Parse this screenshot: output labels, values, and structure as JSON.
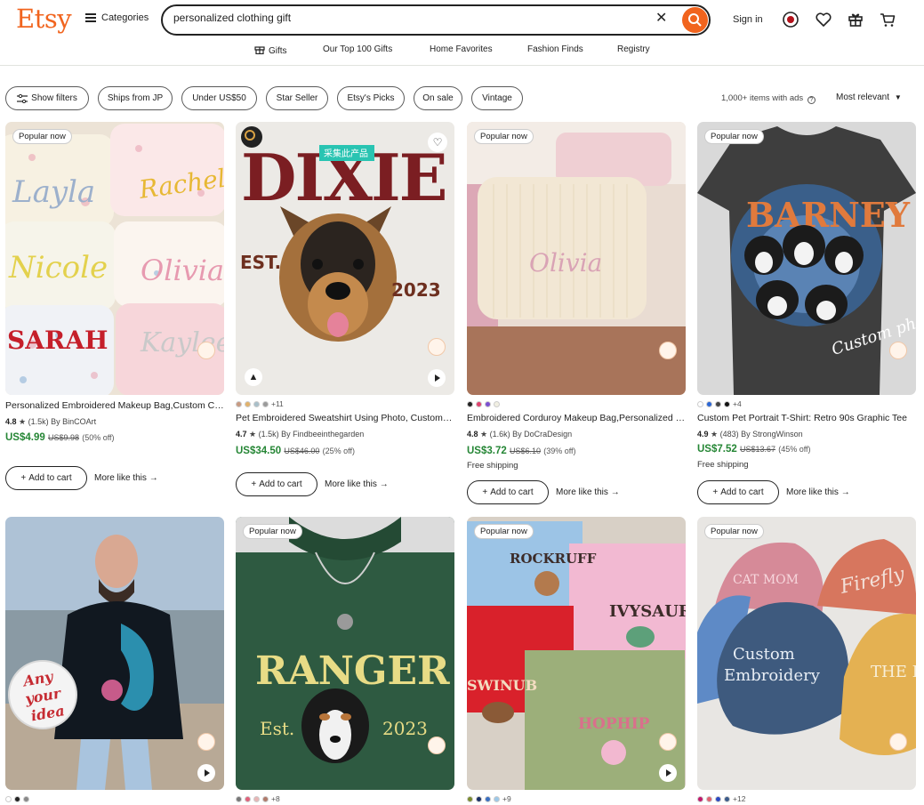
{
  "header": {
    "logo": "Etsy",
    "categories": "Categories",
    "search_value": "personalized clothing gift",
    "signin": "Sign in"
  },
  "nav": [
    "Gifts",
    "Our Top 100 Gifts",
    "Home Favorites",
    "Fashion Finds",
    "Registry"
  ],
  "filters": [
    "Show filters",
    "Ships from JP",
    "Under US$50",
    "Star Seller",
    "Etsy's Picks",
    "On sale",
    "Vintage"
  ],
  "results": {
    "count": "1,000+ items with ads",
    "sort": "Most relevant"
  },
  "common": {
    "add_to_cart": "Add to cart",
    "more_like_this": "More like this",
    "popular_now": "Popular now"
  },
  "products": [
    {
      "title": "Personalized Embroidered Makeup Bag,Custom Cosmetic Bag",
      "rating": "4.8",
      "reviews": "(1.5k)",
      "shop": "By BinCOArt",
      "price": "US$4.99",
      "old_price": "US$9.98",
      "discount": "(50% off)",
      "swatches": [],
      "more": "",
      "image_text": [
        "Layla",
        "Rachel",
        "Nicole",
        "Olivia",
        "SARAH",
        "Kaylee"
      ]
    },
    {
      "title": "Pet Embroidered Sweatshirt Using Photo, Custom Dog Sweatshirt",
      "rating": "4.7",
      "reviews": "(1.5k)",
      "shop": "By Findbeeinthegarden",
      "price": "US$34.50",
      "old_price": "US$46.00",
      "discount": "(25% off)",
      "swatches": [
        "#c79a82",
        "#e2b26a",
        "#a8bfc9",
        "#9a9a9a"
      ],
      "more": "+11",
      "image_text": [
        "DIXIE",
        "EST.",
        "2023",
        "采集此产品"
      ]
    },
    {
      "title": "Embroidered Corduroy Makeup Bag,Personalized Gift",
      "rating": "4.8",
      "reviews": "(1.6k)",
      "shop": "By DoCraDesign",
      "price": "US$3.72",
      "old_price": "US$6.10",
      "discount": "(39% off)",
      "shipping": "Free shipping",
      "swatches": [
        "#222222",
        "#e0416d",
        "#7b4fd1",
        "#f1efe2"
      ],
      "more": "",
      "image_text": [
        "Olivia"
      ]
    },
    {
      "title": "Custom Pet Portrait T-Shirt: Retro 90s Graphic Tee",
      "rating": "4.9",
      "reviews": "(483)",
      "shop": "By StrongWinson",
      "price": "US$7.52",
      "old_price": "US$13.67",
      "discount": "(45% off)",
      "shipping": "Free shipping",
      "swatches": [
        "#ffffff",
        "#2a66d6",
        "#444444",
        "#111111"
      ],
      "more": "+4",
      "image_text": [
        "BARNEY",
        "Custom photo here"
      ]
    },
    {
      "swatches": [
        "#ffffff",
        "#222222",
        "#888888"
      ],
      "more": "",
      "image_text": [
        "Any your idea"
      ]
    },
    {
      "swatches": [
        "#777777",
        "#e0607a",
        "#e7b5b5",
        "#b07a6a"
      ],
      "more": "+8",
      "image_text": [
        "RANGER",
        "Est.",
        "2023"
      ]
    },
    {
      "swatches": [
        "#7a8b2e",
        "#1a2f66",
        "#3a6fc1",
        "#9cc8e8"
      ],
      "more": "+9",
      "image_text": [
        "ROCKRUFF",
        "IVYSAUR",
        "SWINUB",
        "HOPHIP"
      ]
    },
    {
      "swatches": [
        "#c2186b",
        "#e06070",
        "#2a48c2",
        "#3a5a8a"
      ],
      "more": "+12",
      "image_text": [
        "CAT MOM",
        "Firefly",
        "Custom Embroidery",
        "THE PA"
      ]
    }
  ],
  "colors": {
    "accent": "#f1641e",
    "price_green": "#258635"
  }
}
